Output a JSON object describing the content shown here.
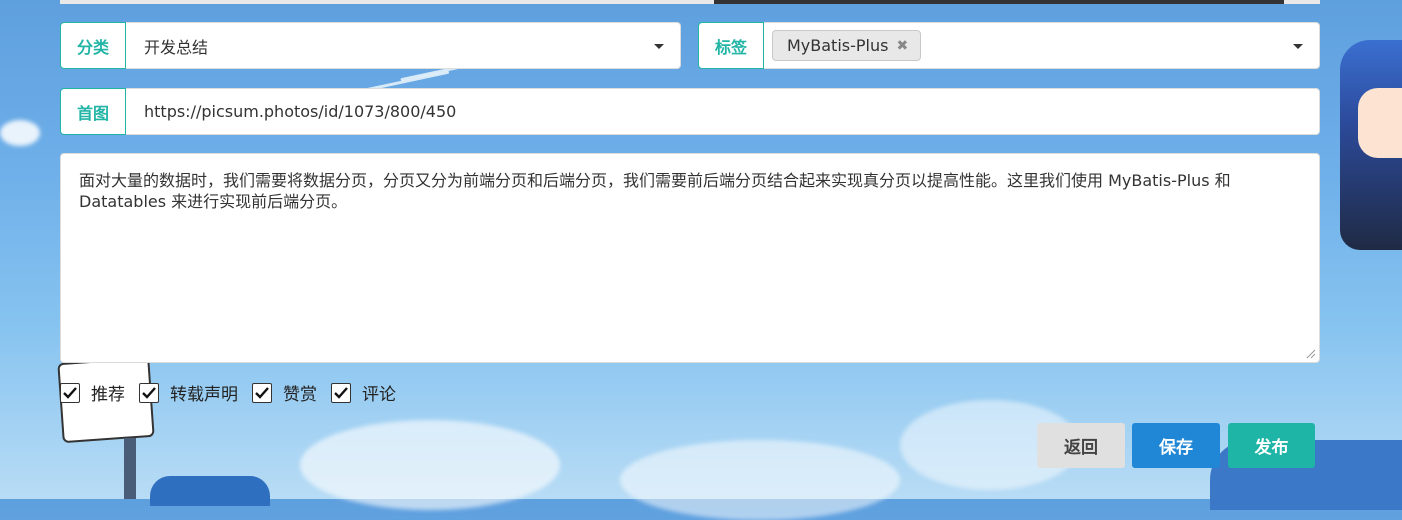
{
  "form": {
    "category": {
      "label": "分类",
      "value": "开发总结"
    },
    "tags": {
      "label": "标签",
      "selected": [
        "MyBatis-Plus"
      ]
    },
    "cover": {
      "label": "首图",
      "value": "https://picsum.photos/id/1073/800/450"
    },
    "description": "面对大量的数据时，我们需要将数据分页，分页又分为前端分页和后端分页，我们需要前后端分页结合起来实现真分页以提高性能。这里我们使用 MyBatis-Plus 和 Datatables 来进行实现前后端分页。",
    "options": [
      {
        "label": "推荐",
        "checked": true
      },
      {
        "label": "转载声明",
        "checked": true
      },
      {
        "label": "赞赏",
        "checked": true
      },
      {
        "label": "评论",
        "checked": true
      }
    ]
  },
  "actions": {
    "back_label": "返回",
    "save_label": "保存",
    "publish_label": "发布"
  },
  "colors": {
    "accent": "#22b5a6",
    "save": "#1f87d6",
    "publish": "#1fb5a6",
    "back": "#e0e0e0"
  }
}
